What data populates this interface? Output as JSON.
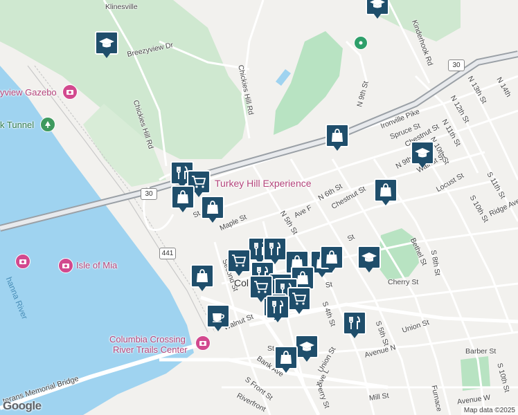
{
  "roads": [
    "Klinesville",
    "Breezyview Dr",
    "Chickies Hill Rd",
    "Chickies Hill Rd",
    "Kinderhook Rd",
    "N 9th St",
    "Ironville Pike",
    "Spruce St",
    "N 12th St",
    "N 13th St",
    "N 14th",
    "N 11th St",
    "N 10th St",
    "Chestnut St",
    "N 9th St",
    "Walnut St",
    "Locust St",
    "S 11th St",
    "Ridge Ave",
    "S 10th St",
    "Maple St",
    "N 5th St",
    "Ave F",
    "N 6th St",
    "Chestnut St",
    "Bethel St",
    "S 8th St",
    "Cherry St",
    "Walnut St",
    "Union St",
    "S 5th St",
    "Avenue N",
    "S 4th St",
    "Union St",
    "Bank Ave",
    "Ave L",
    "Perry St",
    "S Front St",
    "Riverfront",
    "Mill St",
    "Barber St",
    "Avenue W",
    "S 10th St",
    "Furnace",
    "St",
    "Second St",
    "St",
    "St",
    "St"
  ],
  "places": {
    "gazebo": "yview Gazebo",
    "tunnel": "k Tunnel",
    "turkey_hill": "Turkey Hill Experience",
    "isle_of_mia": "Isle of Mia",
    "crossing_line1": "Columbia Crossing",
    "crossing_line2": "River Trails Center",
    "river": "hanna River",
    "bridge": "terans Memorial Bridge",
    "town": "Col"
  },
  "highways": [
    "30",
    "30",
    "441"
  ],
  "markers": [
    {
      "icon": "graduation-cap-icon"
    },
    {
      "icon": "graduation-cap-icon"
    },
    {
      "icon": "shopping-bag-icon"
    },
    {
      "icon": "graduation-cap-icon"
    },
    {
      "icon": "shopping-bag-icon"
    },
    {
      "icon": "restaurant-icon"
    },
    {
      "icon": "shopping-cart-icon"
    },
    {
      "icon": "shopping-bag-icon"
    },
    {
      "icon": "shopping-bag-icon"
    },
    {
      "icon": "restaurant-icon"
    },
    {
      "icon": "restaurant-icon"
    },
    {
      "icon": "shopping-cart-icon"
    },
    {
      "icon": "shopping-bag-icon"
    },
    {
      "icon": "shopping-bag-icon"
    },
    {
      "icon": "shopping-bag-icon"
    },
    {
      "icon": "shopping-bag-icon"
    },
    {
      "icon": "graduation-cap-icon"
    },
    {
      "icon": "shopping-bag-icon"
    },
    {
      "icon": "restaurant-icon"
    },
    {
      "icon": "shopping-cart-icon"
    },
    {
      "icon": "restaurant-icon"
    },
    {
      "icon": "shopping-cart-icon"
    },
    {
      "icon": "restaurant-icon"
    },
    {
      "icon": "shopping-cart-icon"
    },
    {
      "icon": "restaurant-icon"
    },
    {
      "icon": "coffee-cup-icon"
    },
    {
      "icon": "restaurant-icon"
    },
    {
      "icon": "graduation-cap-icon"
    },
    {
      "icon": "shopping-bag-icon"
    }
  ],
  "footer": {
    "logo": "Google",
    "attribution": "Map data ©2025"
  }
}
